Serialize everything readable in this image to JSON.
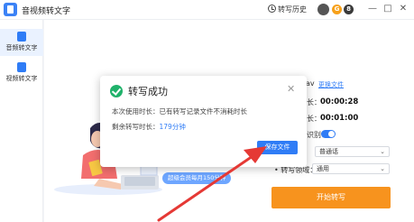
{
  "app": {
    "title": "音视频转文字"
  },
  "titlebar": {
    "history_label": "转写历史",
    "badge_1": "G",
    "badge_2": "8",
    "minimize": "—",
    "maximize": "□",
    "close": "✕"
  },
  "sidebar": {
    "items": [
      {
        "label": "音频转文字",
        "active": true
      },
      {
        "label": "视频转文字",
        "active": false
      }
    ]
  },
  "main": {
    "file_name_partial": "av",
    "change_file_link": "更换文件",
    "duration_label": "长：",
    "duration_value": "00:00:28",
    "time_label": "长：",
    "time_value": "00:01:00",
    "toggle_label": "识别：",
    "language_value": "普通话",
    "domain_label": "• 转写领域：",
    "domain_value": "通用",
    "start_button": "开始转写"
  },
  "dialog": {
    "title": "转写成功",
    "close": "✕",
    "line1": "本次使用时长：已有转写记录文件不消耗时长",
    "remaining_label": "剩余转写时长：",
    "remaining_value": "179分钟",
    "save_button": "保存文件"
  },
  "promo": {
    "text": "超级会员每月150分钟"
  },
  "colors": {
    "accent": "#2f7cf6",
    "success": "#20b26b",
    "orange": "#f7931e",
    "arrow": "#e53935"
  }
}
